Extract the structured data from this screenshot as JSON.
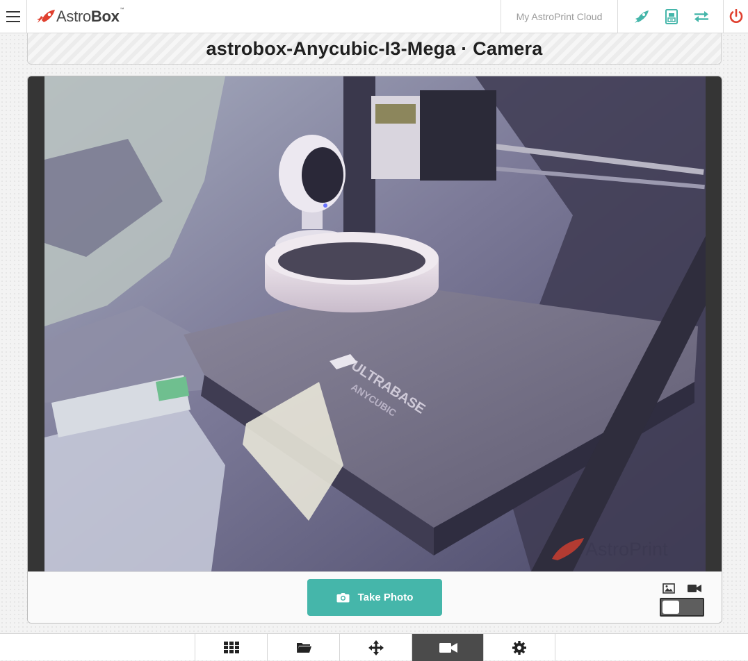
{
  "header": {
    "logo_primary": "Astro",
    "logo_secondary": "Box",
    "logo_mark": "™",
    "cloud_link": "My AstroPrint Cloud",
    "icons": [
      "astroprint-rocket-icon",
      "printer-file-icon",
      "transfer-arrows-icon",
      "power-icon"
    ],
    "accent_color": "#45b6aa",
    "power_color": "#e0402f"
  },
  "page": {
    "title": "astrobox-Anycubic-I3-Mega · Camera"
  },
  "camera": {
    "watermark": "AstroPrint",
    "bed_label": "ULTRABASE",
    "bed_sublabel": "ANYCUBIC",
    "take_photo_label": "Take Photo",
    "mode_icons": [
      "image-icon",
      "video-icon"
    ],
    "mode_toggle_value": "photo"
  },
  "bottom_nav": {
    "items": [
      {
        "name": "dashboard",
        "icon": "grid-icon"
      },
      {
        "name": "files",
        "icon": "folder-icon"
      },
      {
        "name": "control",
        "icon": "move-arrows-icon"
      },
      {
        "name": "camera",
        "icon": "video-camera-icon",
        "active": true
      },
      {
        "name": "settings",
        "icon": "gear-icon"
      }
    ]
  }
}
